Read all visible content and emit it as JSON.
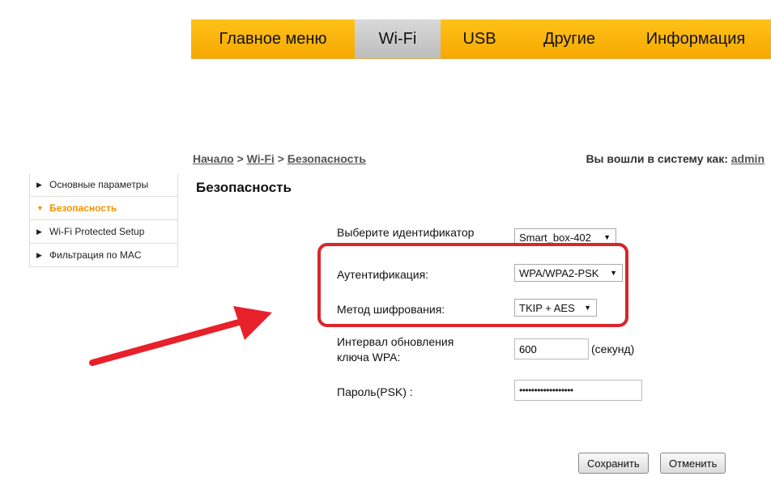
{
  "nav": {
    "tabs": [
      "Главное меню",
      "Wi-Fi",
      "USB",
      "Другие",
      "Информация"
    ]
  },
  "breadcrumb": {
    "home": "Начало",
    "sep": ">",
    "wifi": "Wi-Fi",
    "current": "Безопасность"
  },
  "login": {
    "prefix": "Вы вошли в систему как:",
    "user": "admin"
  },
  "sidebar": {
    "items": [
      {
        "label": "Основные параметры"
      },
      {
        "label": "Безопасность"
      },
      {
        "label": "Wi-Fi Protected Setup"
      },
      {
        "label": "Фильтрация по MAC"
      }
    ]
  },
  "page": {
    "title": "Безопасность"
  },
  "form": {
    "ssid_label": "Выберите идентификатор",
    "ssid_value": "Smart_box-402",
    "auth_label": "Аутентификация:",
    "auth_value": "WPA/WPA2-PSK",
    "enc_label": "Метод шифрования:",
    "enc_value": "TKIP + AES",
    "interval_label_1": "Интервал обновления",
    "interval_label_2": "ключа WPA:",
    "interval_value": "600",
    "interval_unit": "(секунд)",
    "psk_label": "Пароль(PSK) :",
    "psk_value": "••••••••••••••••••"
  },
  "buttons": {
    "save": "Сохранить",
    "cancel": "Отменить"
  },
  "colors": {
    "nav_bg": "#f6a800",
    "nav_active": "#c8c8c8",
    "sidebar_active": "#f29400",
    "highlight": "#d8262a"
  }
}
